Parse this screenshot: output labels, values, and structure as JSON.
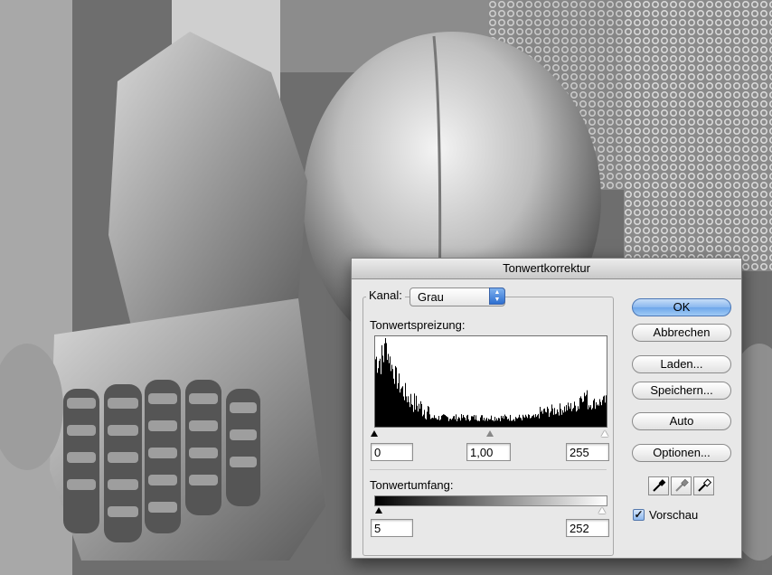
{
  "dialog": {
    "title": "Tonwertkorrektur",
    "channel_label": "Kanal:",
    "channel_value": "Grau",
    "input_levels_label": "Tonwertspreizung:",
    "input_black": "0",
    "input_gamma": "1,00",
    "input_white": "255",
    "output_levels_label": "Tonwertumfang:",
    "output_black": "5",
    "output_white": "252",
    "buttons": {
      "ok": "OK",
      "cancel": "Abbrechen",
      "load": "Laden...",
      "save": "Speichern...",
      "auto": "Auto",
      "options": "Optionen..."
    },
    "preview_label": "Vorschau",
    "preview_checked": true,
    "eyedroppers": [
      "black-eyedropper-icon",
      "gray-eyedropper-icon",
      "white-eyedropper-icon"
    ]
  }
}
